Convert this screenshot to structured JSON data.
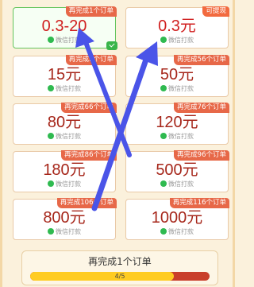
{
  "cards": [
    {
      "badge": "再完成1个订单",
      "amount": "0.3-20",
      "pay": "微信打款"
    },
    {
      "badge": "可提现",
      "amount": "0.3元",
      "pay": "微信打款"
    },
    {
      "badge": "再完成5个订单",
      "amount": "15元",
      "pay": "微信打款"
    },
    {
      "badge": "再完成56个订单",
      "amount": "50元",
      "pay": "微信打款"
    },
    {
      "badge": "再完成66个订单",
      "amount": "80元",
      "pay": "微信打款"
    },
    {
      "badge": "再完成76个订单",
      "amount": "120元",
      "pay": "微信打款"
    },
    {
      "badge": "再完成86个订单",
      "amount": "180元",
      "pay": "微信打款"
    },
    {
      "badge": "再完成96个订单",
      "amount": "500元",
      "pay": "微信打款"
    },
    {
      "badge": "再完成106个订单",
      "amount": "800元",
      "pay": "微信打款"
    },
    {
      "badge": "再完成116个订单",
      "amount": "1000元",
      "pay": "微信打款"
    }
  ],
  "bottom": {
    "title": "再完成1个订单",
    "progress_text": "4/5",
    "progress": 0.8
  },
  "colors": {
    "accent_red": "#e76848",
    "active_green": "#39b54a",
    "progress_yellow": "#ffcc22",
    "arrow_blue": "#4a54e8"
  }
}
